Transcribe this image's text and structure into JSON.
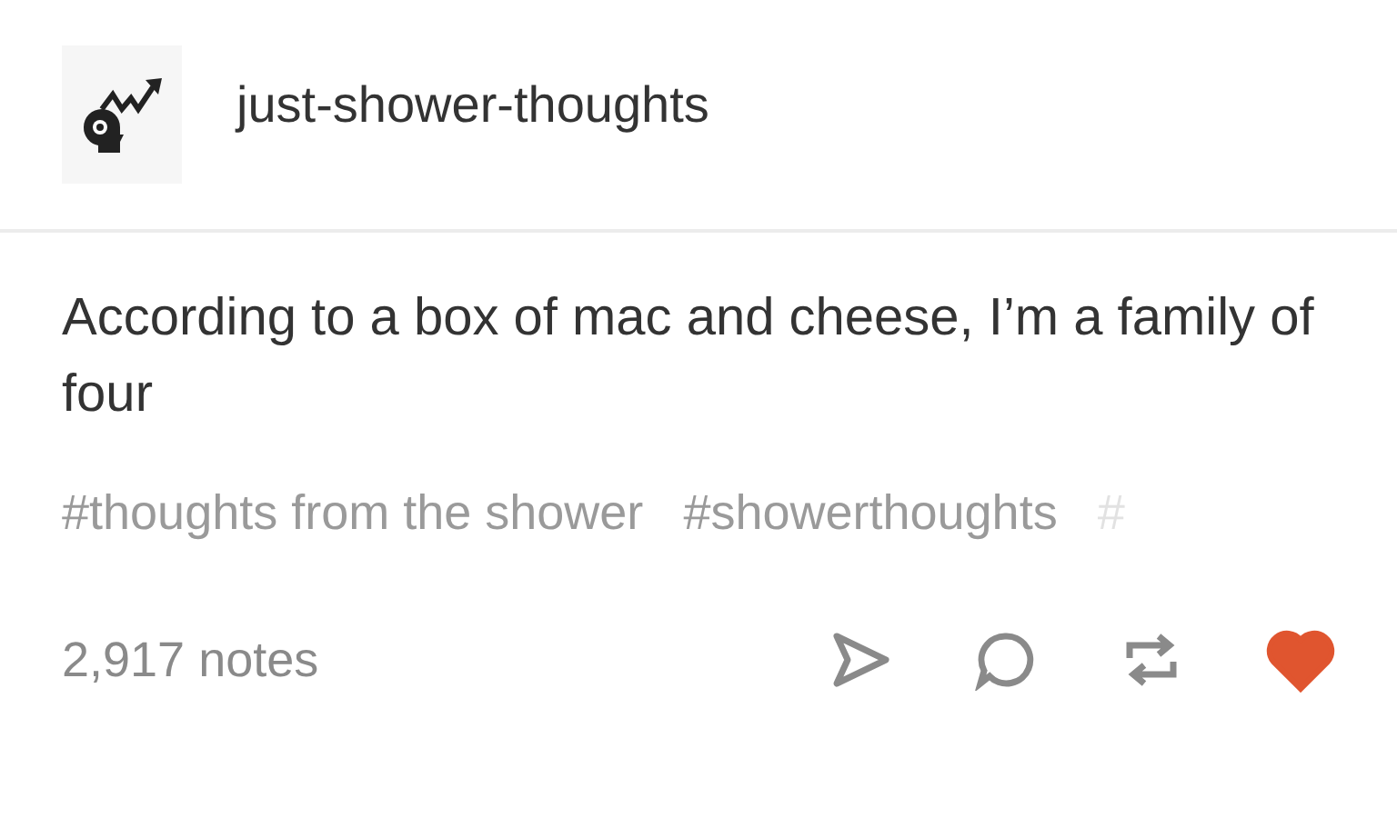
{
  "blog": {
    "name": "just-shower-thoughts"
  },
  "post": {
    "text": "According to a box of mac and cheese, I’m a family of four"
  },
  "tags": [
    {
      "label": "#thoughts from the shower",
      "faded": false
    },
    {
      "label": "#showerthoughts",
      "faded": false
    },
    {
      "label": "#",
      "faded": true
    }
  ],
  "footer": {
    "notes": "2,917 notes",
    "liked": true
  }
}
